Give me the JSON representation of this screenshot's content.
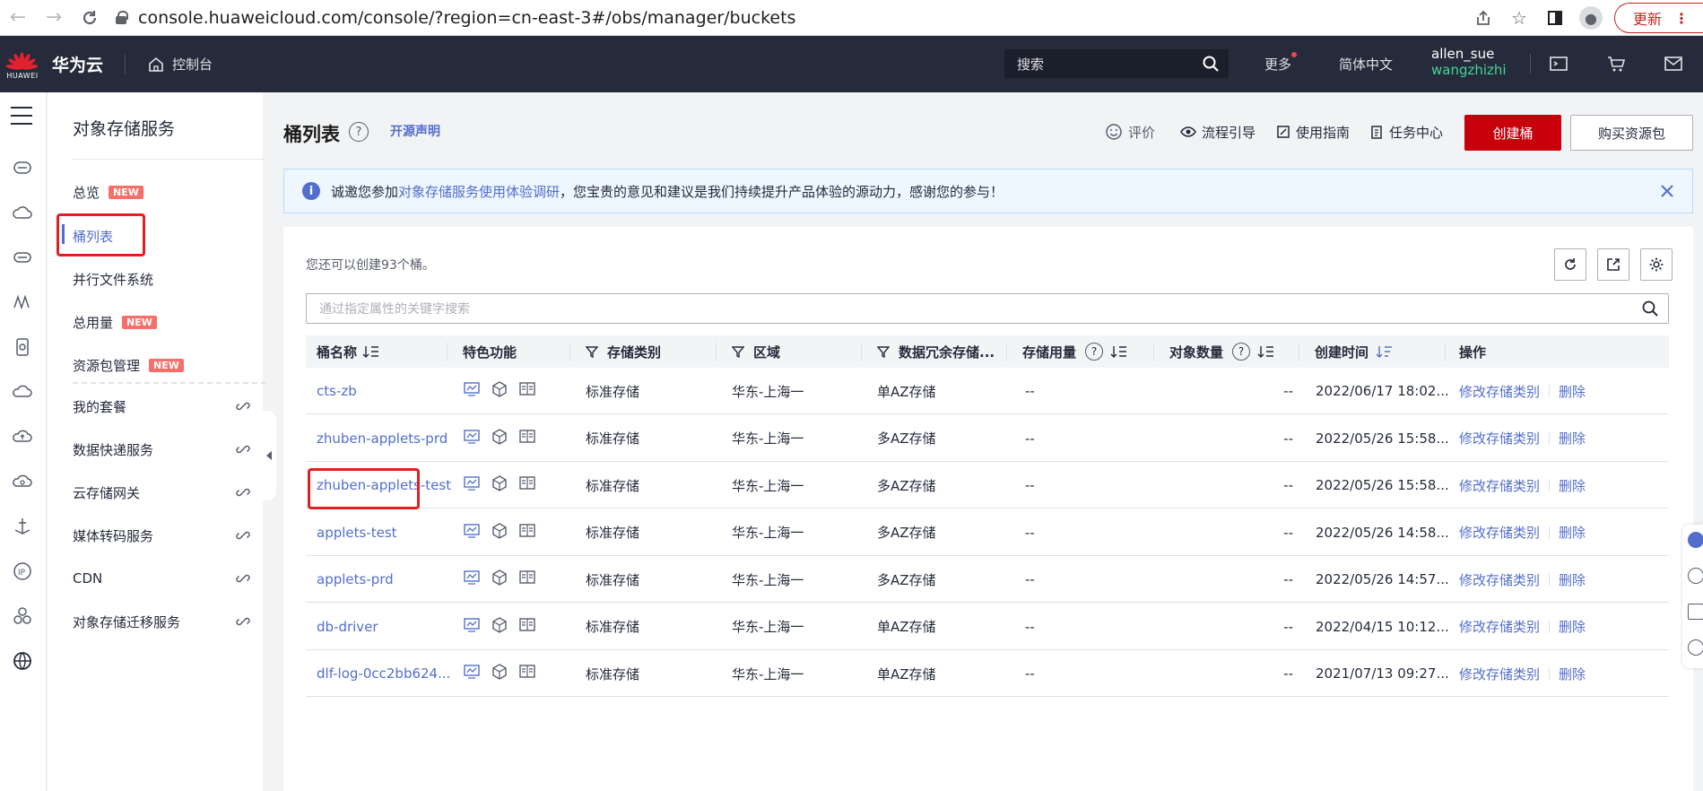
{
  "browser": {
    "url": "console.huaweicloud.com/console/?region=cn-east-3#/obs/manager/buckets",
    "update_label": "更新"
  },
  "topnav": {
    "logo_text": "HUAWEI",
    "brand": "华为云",
    "console_label": "控制台",
    "search_placeholder": "搜索",
    "more_label": "更多",
    "language_label": "简体中文",
    "user_name": "allen_sue",
    "user_account": "wangzhizhi"
  },
  "sidebar": {
    "service_title": "对象存储服务",
    "items": [
      {
        "label": "总览",
        "badge": "NEW"
      },
      {
        "label": "桶列表",
        "badge": ""
      },
      {
        "label": "并行文件系统",
        "badge": ""
      },
      {
        "label": "总用量",
        "badge": "NEW"
      },
      {
        "label": "资源包管理",
        "badge": "NEW"
      },
      {
        "label": "我的套餐",
        "badge": ""
      },
      {
        "label": "数据快递服务",
        "badge": ""
      },
      {
        "label": "云存储网关",
        "badge": ""
      },
      {
        "label": "媒体转码服务",
        "badge": ""
      },
      {
        "label": "CDN",
        "badge": ""
      },
      {
        "label": "对象存储迁移服务",
        "badge": ""
      }
    ]
  },
  "header": {
    "title": "桶列表",
    "open_source_label": "开源声明",
    "rate_label": "评价",
    "guide_label": "流程引导",
    "manual_label": "使用指南",
    "task_center_label": "任务中心",
    "create_button": "创建桶",
    "buy_button": "购买资源包"
  },
  "notice": {
    "prefix": "诚邀您参加",
    "link": "对象存储服务使用体验调研",
    "suffix": "，您宝贵的意见和建议是我们持续提升产品体验的源动力，感谢您的参与！"
  },
  "table": {
    "quota_text": "您还可以创建93个桶。",
    "search_placeholder": "通过指定属性的关键字搜索",
    "columns": [
      "桶名称",
      "特色功能",
      "存储类别",
      "区域",
      "数据冗余存储...",
      "存储用量",
      "对象数量",
      "创建时间",
      "操作"
    ],
    "op_modify": "修改存储类别",
    "op_delete": "删除",
    "rows": [
      {
        "name": "cts-zb",
        "storage_class": "标准存储",
        "region": "华东-上海一",
        "redundancy": "单AZ存储",
        "usage": "--",
        "objects": "--",
        "created": "2022/06/17 18:02..."
      },
      {
        "name": "zhuben-applets-prd",
        "storage_class": "标准存储",
        "region": "华东-上海一",
        "redundancy": "多AZ存储",
        "usage": "--",
        "objects": "--",
        "created": "2022/05/26 15:58..."
      },
      {
        "name": "zhuben-applets-test",
        "storage_class": "标准存储",
        "region": "华东-上海一",
        "redundancy": "多AZ存储",
        "usage": "--",
        "objects": "--",
        "created": "2022/05/26 15:58..."
      },
      {
        "name": "applets-test",
        "storage_class": "标准存储",
        "region": "华东-上海一",
        "redundancy": "多AZ存储",
        "usage": "--",
        "objects": "--",
        "created": "2022/05/26 14:58..."
      },
      {
        "name": "applets-prd",
        "storage_class": "标准存储",
        "region": "华东-上海一",
        "redundancy": "多AZ存储",
        "usage": "--",
        "objects": "--",
        "created": "2022/05/26 14:57..."
      },
      {
        "name": "db-driver",
        "storage_class": "标准存储",
        "region": "华东-上海一",
        "redundancy": "单AZ存储",
        "usage": "--",
        "objects": "--",
        "created": "2022/04/15 10:12..."
      },
      {
        "name": "dlf-log-0cc2bb624...",
        "storage_class": "标准存储",
        "region": "华东-上海一",
        "redundancy": "单AZ存储",
        "usage": "--",
        "objects": "--",
        "created": "2021/07/13 09:27..."
      }
    ]
  },
  "colors": {
    "accent": "#526ecc",
    "primary_button": "#c7000b",
    "top_bar": "#252b3a",
    "highlight": "#e02020",
    "new_badge": "#f66f6a"
  }
}
